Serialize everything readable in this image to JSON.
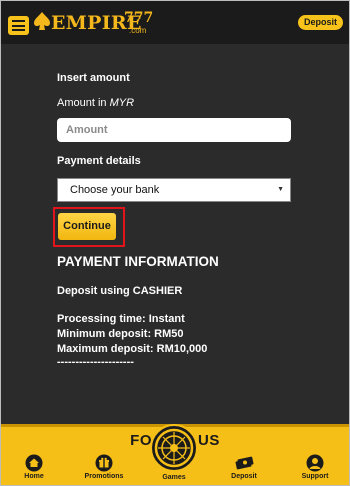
{
  "header": {
    "logo_word": "EMPIRE",
    "logo_number": "777",
    "logo_domain": ".com",
    "deposit_label": "Deposit"
  },
  "form": {
    "insert_amount": "Insert amount",
    "amount_in_prefix": "Amount in",
    "currency": "MYR",
    "amount_placeholder": "Amount",
    "payment_details": "Payment details",
    "bank_select_value": "Choose your bank",
    "continue_label": "Continue"
  },
  "payment_info": {
    "title": "PAYMENT INFORMATION",
    "method": "Deposit using CASHIER",
    "processing_time": "Processing time: Instant",
    "minimum_deposit": "Minimum deposit: RM50",
    "maximum_deposit": "Maximum deposit: RM10,000",
    "divider": "---------------------"
  },
  "footer": {
    "follow_left": "FO",
    "follow_right": "US",
    "nav": [
      {
        "label": "Home",
        "icon": "home-icon"
      },
      {
        "label": "Promotions",
        "icon": "gift-icon"
      },
      {
        "label": "Games",
        "icon": "roulette-icon"
      },
      {
        "label": "Deposit",
        "icon": "money-icon"
      },
      {
        "label": "Support",
        "icon": "support-icon"
      }
    ]
  },
  "colors": {
    "accent": "#f7c31a",
    "background": "#2b2b2b",
    "header": "#1b1b1b",
    "highlight_border": "#e0141a"
  }
}
